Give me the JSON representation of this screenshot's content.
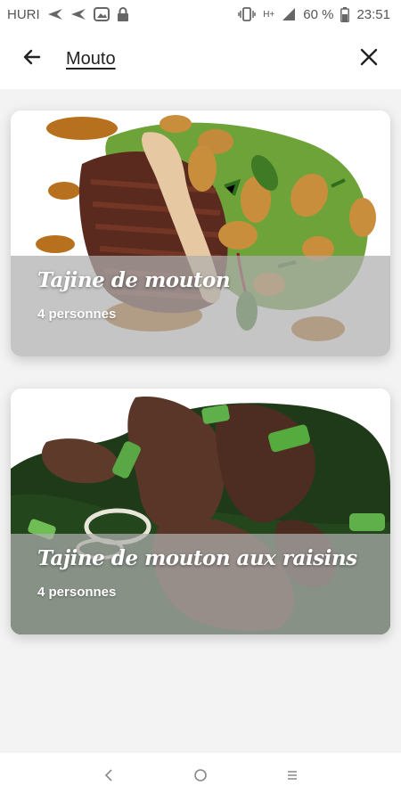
{
  "status_bar": {
    "carrier": "HURI",
    "network": "H+",
    "battery": "60 %",
    "time": "23:51",
    "icons": [
      "send-icon",
      "send-icon",
      "gallery-icon",
      "lock-icon",
      "vibrate-icon",
      "signal-icon",
      "battery-icon"
    ]
  },
  "search": {
    "value": "Mouto",
    "back_icon": "arrow-left-icon",
    "clear_icon": "close-icon"
  },
  "results": [
    {
      "title": "Tajine de mouton",
      "subtitle": "4 personnes"
    },
    {
      "title": "Tajine de mouton aux raisins",
      "subtitle": "4 personnes"
    }
  ],
  "nav_bar": {
    "icons": [
      "back-nav-icon",
      "home-nav-icon",
      "recents-nav-icon"
    ]
  },
  "colors": {
    "accent_cursor": "#7c4dff",
    "overlay": "#afafaf"
  }
}
